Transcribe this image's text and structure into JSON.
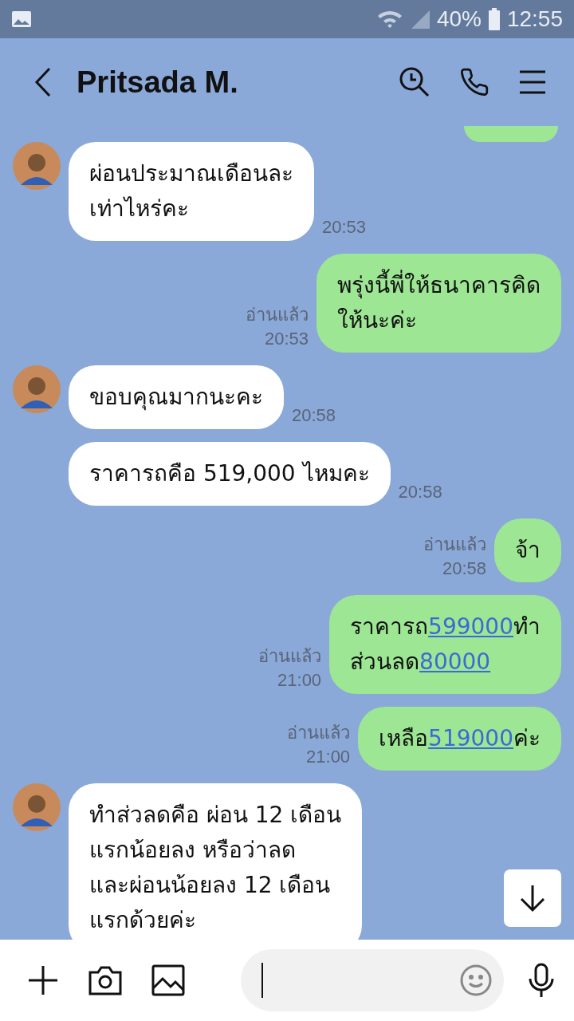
{
  "status_bar": {
    "battery": "40%",
    "time": "12:55"
  },
  "header": {
    "title": "Pritsada M."
  },
  "messages": [
    {
      "kind": "incoming",
      "avatar": true,
      "segments": [
        {
          "kind": "text",
          "text": "ผ่อนประมาณเดือนละ\nเท่าไหร่คะ"
        }
      ],
      "time": "20:53"
    },
    {
      "kind": "outgoing",
      "read": "อ่านแล้ว",
      "segments": [
        {
          "kind": "text",
          "text": "พรุ่งนี้พี่ให้ธนาคารคิด\nให้นะค่ะ"
        }
      ],
      "time": "20:53"
    },
    {
      "kind": "incoming",
      "avatar": true,
      "segments": [
        {
          "kind": "text",
          "text": "ขอบคุณมากนะคะ"
        }
      ],
      "time": "20:58"
    },
    {
      "kind": "incoming",
      "avatar": false,
      "segments": [
        {
          "kind": "text",
          "text": "ราคารถคือ 519,000 ไหมคะ"
        }
      ],
      "time": "20:58"
    },
    {
      "kind": "outgoing",
      "read": "อ่านแล้ว",
      "segments": [
        {
          "kind": "text",
          "text": "จ้า"
        }
      ],
      "time": "20:58"
    },
    {
      "kind": "outgoing",
      "read": "อ่านแล้ว",
      "segments": [
        {
          "kind": "text",
          "text": "ราคารถ"
        },
        {
          "kind": "link",
          "text": "599000"
        },
        {
          "kind": "text",
          "text": "ทำ\nส่วนลด"
        },
        {
          "kind": "link",
          "text": "80000"
        }
      ],
      "time": "21:00"
    },
    {
      "kind": "outgoing",
      "read": "อ่านแล้ว",
      "segments": [
        {
          "kind": "text",
          "text": "เหลือ"
        },
        {
          "kind": "link",
          "text": "519000"
        },
        {
          "kind": "text",
          "text": "ค่ะ"
        }
      ],
      "time": "21:00"
    },
    {
      "kind": "incoming",
      "avatar": true,
      "segments": [
        {
          "kind": "text",
          "text": "ทำส่วลดคือ ผ่อน 12 เดือน\nแรกน้อยลง หรือว่าลด\nและผ่อนน้อยลง 12 เดือน\nแรกด้วยค่ะ"
        }
      ]
    }
  ]
}
